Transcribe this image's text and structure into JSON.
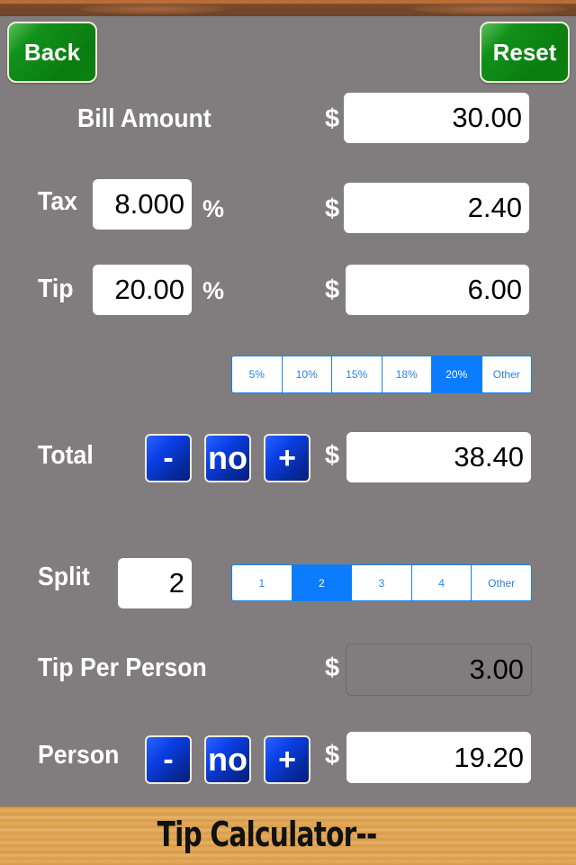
{
  "header": {
    "back_label": "Back",
    "reset_label": "Reset"
  },
  "bill": {
    "label": "Bill Amount",
    "currency": "$",
    "amount": "30.00"
  },
  "tax": {
    "label": "Tax",
    "rate": "8.000",
    "percent_sign": "%",
    "currency": "$",
    "amount": "2.40"
  },
  "tip": {
    "label": "Tip",
    "rate": "20.00",
    "percent_sign": "%",
    "currency": "$",
    "amount": "6.00",
    "presets": [
      {
        "label": "5%",
        "selected": false
      },
      {
        "label": "10%",
        "selected": false
      },
      {
        "label": "15%",
        "selected": false
      },
      {
        "label": "18%",
        "selected": false
      },
      {
        "label": "20%",
        "selected": true
      },
      {
        "label": "Other",
        "selected": false
      }
    ]
  },
  "total": {
    "label": "Total",
    "minus_label": "-",
    "round_label": "no",
    "plus_label": "+",
    "currency": "$",
    "amount": "38.40"
  },
  "split": {
    "label": "Split",
    "count": "2",
    "options": [
      {
        "label": "1",
        "selected": false
      },
      {
        "label": "2",
        "selected": true
      },
      {
        "label": "3",
        "selected": false
      },
      {
        "label": "4",
        "selected": false
      },
      {
        "label": "Other",
        "selected": false
      }
    ]
  },
  "tip_per_person": {
    "label": "Tip Per Person",
    "currency": "$",
    "amount": "3.00"
  },
  "person": {
    "label": "Person",
    "minus_label": "-",
    "round_label": "no",
    "plus_label": "+",
    "currency": "$",
    "amount": "19.20"
  },
  "footer": {
    "title": "Tip Calculator--"
  },
  "colors": {
    "accent_blue": "#0b7cfd",
    "green_button": "#0b7d10",
    "background": "#817d7f"
  }
}
